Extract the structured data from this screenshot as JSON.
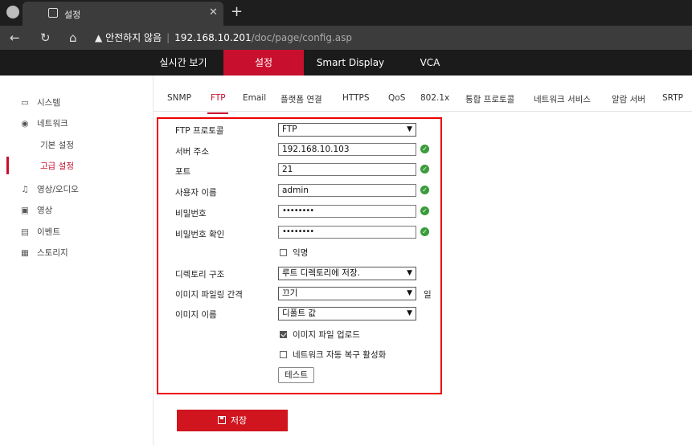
{
  "browser": {
    "tab_title": "설정",
    "address": {
      "warning": "안전하지 않음",
      "host": "192.168.10.201",
      "path": "/doc/page/config.asp"
    }
  },
  "topnav": {
    "items": [
      "실시간 보기",
      "설정",
      "Smart Display",
      "VCA"
    ],
    "active": "설정"
  },
  "sidebar": {
    "system": "시스템",
    "network": "네트워크",
    "basic": "기본 설정",
    "advanced": "고급 설정",
    "video_audio": "영상/오디오",
    "image": "영상",
    "event": "이벤트",
    "storage": "스토리지"
  },
  "subtabs": [
    "SNMP",
    "FTP",
    "Email",
    "플랫폼 연결",
    "HTTPS",
    "QoS",
    "802.1x",
    "통합 프로토콜",
    "네트워크 서비스",
    "알람 서버",
    "SRTP"
  ],
  "form": {
    "protocol_label": "FTP 프로토콜",
    "protocol_value": "FTP",
    "server_label": "서버 주소",
    "server_value": "192.168.10.103",
    "port_label": "포트",
    "port_value": "21",
    "user_label": "사용자 이름",
    "user_value": "admin",
    "password_label": "비밀번호",
    "password_value": "••••••••",
    "confirm_label": "비밀번호 확인",
    "confirm_value": "••••••••",
    "anonymous_label": "익명",
    "anonymous_checked": false,
    "dir_label": "디렉토리 구조",
    "dir_value": "루트 디렉토리에 저장.",
    "interval_label": "이미지 파일링 간격",
    "interval_value": "끄기",
    "interval_unit": "일",
    "name_label": "이미지 이름",
    "name_value": "디폴트 값",
    "upload_label": "이미지 파일 업로드",
    "upload_checked": true,
    "recovery_label": "네트워크 자동 복구 활성화",
    "recovery_checked": false,
    "test_button": "테스트"
  },
  "save_button": "저장",
  "colors": {
    "accent": "#c8102e",
    "ok": "#3a9b3a",
    "highlight_box": "#e00000"
  }
}
